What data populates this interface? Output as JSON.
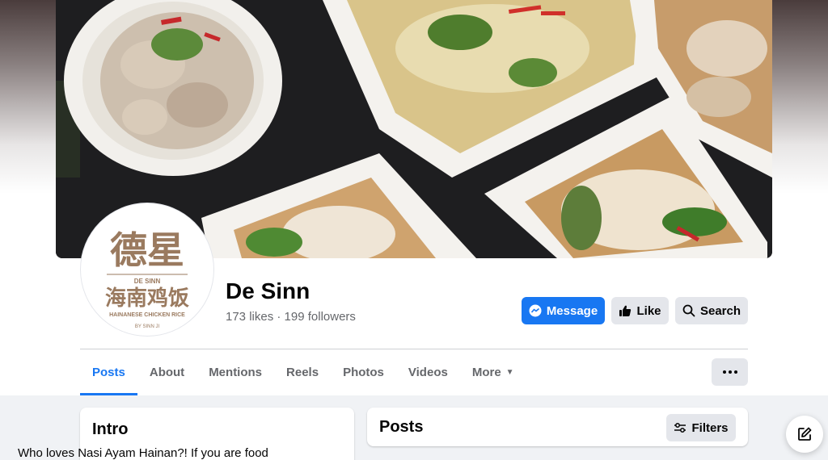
{
  "page": {
    "name": "De Sinn",
    "likes": "173 likes",
    "separator": "·",
    "followers": "199 followers"
  },
  "logo": {
    "chinese_title": "德星",
    "brand": "DE SINN",
    "chinese_subtitle": "海南鸡饭",
    "english": "HAINANESE CHICKEN RICE",
    "by": "BY SINN JI"
  },
  "actions": {
    "message": "Message",
    "like": "Like",
    "search": "Search"
  },
  "tabs": [
    {
      "label": "Posts",
      "active": true
    },
    {
      "label": "About"
    },
    {
      "label": "Mentions"
    },
    {
      "label": "Reels"
    },
    {
      "label": "Photos"
    },
    {
      "label": "Videos"
    },
    {
      "label": "More"
    }
  ],
  "intro": {
    "title": "Intro",
    "text": "Who loves Nasi Ayam Hainan?! If you are food"
  },
  "posts": {
    "title": "Posts",
    "filters": "Filters"
  },
  "colors": {
    "accent": "#1877f2",
    "logo_brown": "#9a7a5f"
  },
  "icons": {
    "message": "messenger-icon",
    "like": "thumbs-up-icon",
    "search": "search-icon",
    "more": "caret-down-icon",
    "options": "more-dots-icon",
    "filters": "sliders-icon",
    "compose": "compose-icon"
  }
}
